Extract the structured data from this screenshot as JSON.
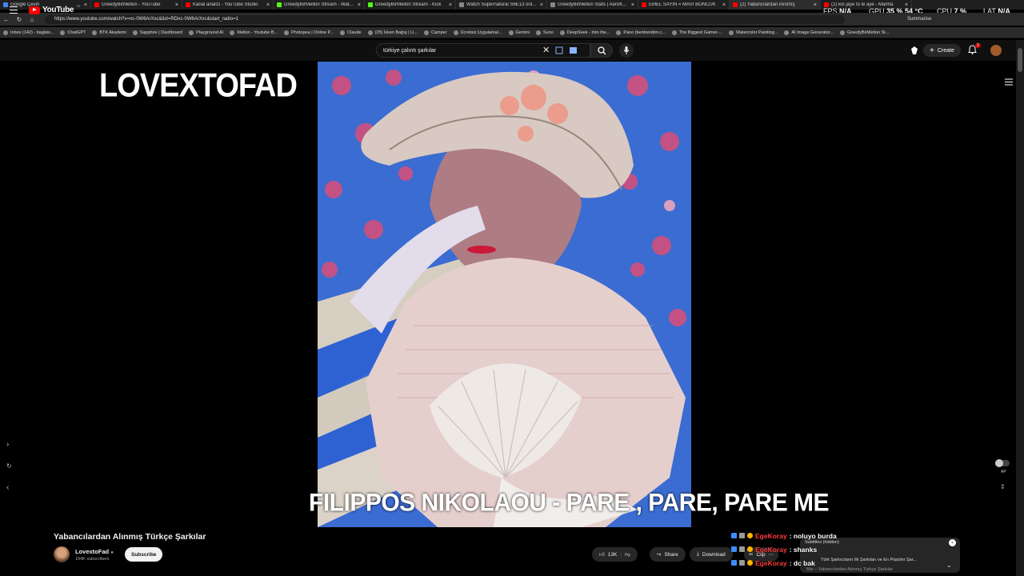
{
  "browser": {
    "tabs": [
      {
        "title": "Google Çeviri",
        "color": "#4285f4"
      },
      {
        "title": "GreedyBirMellon - YouTube",
        "color": "#ff0000"
      },
      {
        "title": "Kanal analizi - YouTube Studio",
        "color": "#ff0000"
      },
      {
        "title": "GreedyBirMellon Stream - Wat...",
        "color": "#53fc18"
      },
      {
        "title": "GreedyBirMellon Stream - Kick",
        "color": "#53fc18"
      },
      {
        "title": "Watch Supernatural S6E13 onl...",
        "color": "#888888"
      },
      {
        "title": "GreedyBirMellon Stats | AeroK...",
        "color": "#888888"
      },
      {
        "title": "EMEL SAYIN = MAVİ BONCUK",
        "color": "#ff0000"
      },
      {
        "title": "(2) Yabancılardan Alınmış",
        "color": "#ff0000"
      },
      {
        "title": "(2) koi jaye to le aye - Mamta",
        "color": "#ff0000"
      }
    ],
    "url": "https://www.youtube.com/watch?v=nc-0W6ArXxc&list=RDnc-0W6ArXxc&start_radio=1",
    "bookmarks": [
      "Inbox (142) - bagisis...",
      "ChatGPT",
      "BTK Akademi",
      "Sapphire | Dashboard",
      "Playground AI",
      "Mellon - Youtube B...",
      "Photopea | Online P...",
      "Claude",
      "(25) İslam Bağış | Li...",
      "Camper",
      "Ücretsiz Uygulamal...",
      "Gemini",
      "Suno",
      "DeepSeek - Into the...",
      "Pano (bentrendim.c...",
      "The Biggest Gamer-...",
      "Watercolor Painting...",
      "AI Image Generator...",
      "GreedyBirMellon St..."
    ]
  },
  "hud": {
    "fps_label": "FPS",
    "fps_value": "N/A",
    "gpu_label": "GPU",
    "gpu_value": "35 % 54 °C",
    "cpu_label": "CPU",
    "cpu_value": "7 %",
    "lat_label": "LAT",
    "lat_value": "N/A",
    "summarise": "Summarise"
  },
  "youtube": {
    "logo": "YouTube",
    "region": "TR",
    "search_query": "türkiye çalıntı şarkılar",
    "create_label": "Create",
    "notification_count": "2"
  },
  "video": {
    "watermark": "LOVEXTOFAD",
    "song_caption": "FILIPPOS NIKOLAOU - PARE , PARE, PARE ME",
    "autoplay_label": "AP",
    "title": "Yabancılardan Alınmış Türkçe Şarkılar",
    "channel_name": "LovextoFad",
    "subscribers": "194K subscribers",
    "subscribe_label": "Subscribe",
    "likes": "13K",
    "share_label": "Share",
    "download_label": "Download",
    "clip_label": "Clip"
  },
  "chat": [
    {
      "user": "EgeKoray",
      "message": ": noluyo burda"
    },
    {
      "user": "EgeKoray",
      "message": ": shanks"
    },
    {
      "user": "EgeKoray",
      "message": ": dc bak"
    }
  ],
  "playlist_panel": {
    "subtitles": "Subtitles (hidden)",
    "now_playing": "Türk Şarkıcıların İlk Şarkıları ve En Popüler Şar...",
    "playlist": "Mix – Yabancılardan Alınmış Türkçe Şarkılar"
  }
}
